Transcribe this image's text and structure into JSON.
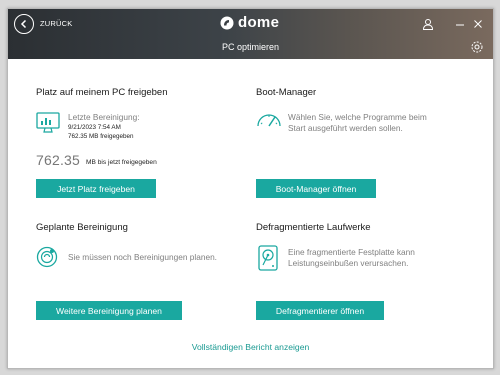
{
  "titlebar": {
    "back_label": "ZURÜCK",
    "brand": "dome",
    "subtitle": "PC optimieren",
    "icons": [
      "back-arrow-icon",
      "user-icon",
      "minimize-icon",
      "close-icon",
      "gear-icon"
    ]
  },
  "cleanup": {
    "title": "Platz auf meinem PC freigeben",
    "last_label": "Letzte Bereinigung:",
    "last_date": "9/21/2023 7:54 AM",
    "last_freed": "762.35 MB freigegeben",
    "total_value": "762.35",
    "total_suffix": "MB bis jetzt freigegeben",
    "button": "Jetzt Platz freigeben"
  },
  "boot": {
    "title": "Boot-Manager",
    "desc_line1": "Wählen Sie, welche Programme beim",
    "desc_line2": "Start ausgeführt werden sollen.",
    "button": "Boot-Manager öffnen"
  },
  "scheduled": {
    "title": "Geplante Bereinigung",
    "desc": "Sie müssen noch Bereinigungen planen.",
    "button": "Weitere Bereinigung planen"
  },
  "defrag": {
    "title": "Defragmentierte Laufwerke",
    "desc_line1": "Eine fragmentierte Festplatte kann",
    "desc_line2": "Leistungseinbußen verursachen.",
    "button": "Defragmentierer öffnen"
  },
  "footer": {
    "report_link": "Vollständigen Bericht anzeigen"
  },
  "colors": {
    "accent": "#1aa8a0",
    "title_text": "#1a1a1a",
    "muted_text": "#808080"
  }
}
